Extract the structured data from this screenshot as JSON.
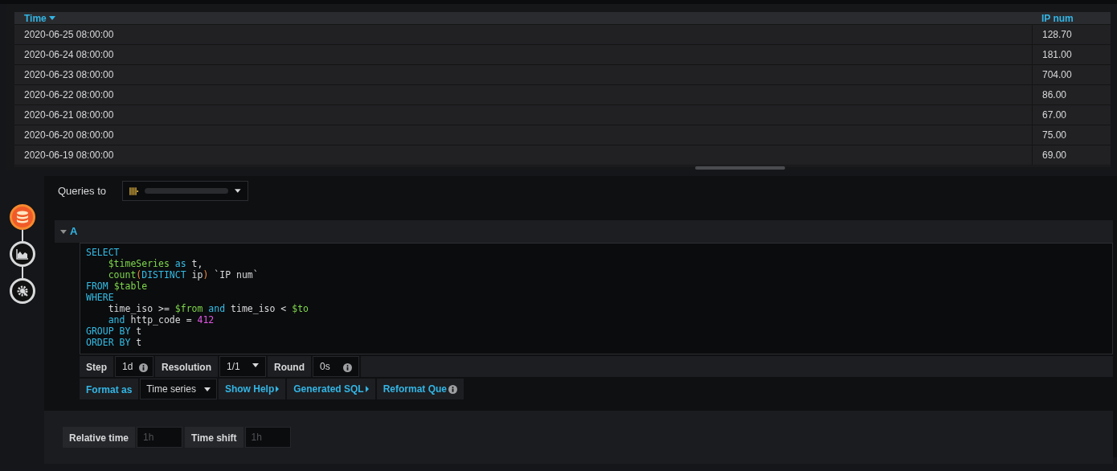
{
  "table": {
    "columns": [
      {
        "label": "Time",
        "sorted": true
      },
      {
        "label": "IP num",
        "sorted": false
      }
    ],
    "rows": [
      [
        "2020-06-25 08:00:00",
        "128.70"
      ],
      [
        "2020-06-24 08:00:00",
        "181.00"
      ],
      [
        "2020-06-23 08:00:00",
        "704.00"
      ],
      [
        "2020-06-22 08:00:00",
        "86.00"
      ],
      [
        "2020-06-21 08:00:00",
        "67.00"
      ],
      [
        "2020-06-20 08:00:00",
        "75.00"
      ],
      [
        "2020-06-19 08:00:00",
        "69.00"
      ]
    ]
  },
  "steps": [
    {
      "kind": "database",
      "selected": true
    },
    {
      "kind": "chart",
      "selected": false
    },
    {
      "kind": "settings",
      "selected": false
    }
  ],
  "queries_to": {
    "label": "Queries to"
  },
  "query": {
    "ref": "A",
    "expanded": true,
    "code": [
      {
        "indent": false,
        "tokens": [
          {
            "kind": "keyword",
            "text": "SELECT"
          }
        ]
      },
      {
        "indent": true,
        "tokens": [
          {
            "kind": "variable",
            "text": "$timeSeries"
          },
          {
            "kind": "keyword",
            "text": " as"
          },
          {
            "kind": "plain",
            "text": " t,"
          }
        ]
      },
      {
        "indent": true,
        "tokens": [
          {
            "kind": "variable",
            "text": "count"
          },
          {
            "kind": "paren",
            "text": "("
          },
          {
            "kind": "keyword",
            "text": "DISTINCT"
          },
          {
            "kind": "plain",
            "text": " ip"
          },
          {
            "kind": "paren",
            "text": ")"
          },
          {
            "kind": "plain",
            "text": " `IP num`"
          }
        ]
      },
      {
        "indent": false,
        "tokens": [
          {
            "kind": "keyword",
            "text": "FROM"
          },
          {
            "kind": "variable",
            "text": " $table"
          }
        ]
      },
      {
        "indent": false,
        "tokens": [
          {
            "kind": "keyword",
            "text": "WHERE"
          }
        ]
      },
      {
        "indent": true,
        "tokens": [
          {
            "kind": "plain",
            "text": "time_iso >= "
          },
          {
            "kind": "variable",
            "text": "$from"
          },
          {
            "kind": "keyword",
            "text": " and"
          },
          {
            "kind": "plain",
            "text": " time_iso < "
          },
          {
            "kind": "variable",
            "text": "$to"
          }
        ]
      },
      {
        "indent": true,
        "tokens": [
          {
            "kind": "keyword",
            "text": "and"
          },
          {
            "kind": "plain",
            "text": " http_code = "
          },
          {
            "kind": "number",
            "text": "412"
          }
        ]
      },
      {
        "indent": false,
        "tokens": [
          {
            "kind": "keyword",
            "text": "GROUP BY"
          },
          {
            "kind": "plain",
            "text": " t"
          }
        ]
      },
      {
        "indent": false,
        "tokens": [
          {
            "kind": "keyword",
            "text": "ORDER BY"
          },
          {
            "kind": "plain",
            "text": " t"
          }
        ]
      }
    ],
    "options": [
      {
        "label": "Step",
        "value": "1d",
        "kind": "info"
      },
      {
        "label": "Resolution",
        "value": "1/1",
        "kind": "select"
      },
      {
        "label": "Round",
        "value": "0s",
        "kind": "info"
      }
    ],
    "format_label": "Format as",
    "format_value": "Time series",
    "links": [
      {
        "label": "Show Help",
        "kind": "toggle"
      },
      {
        "label": "Generated SQL",
        "kind": "toggle"
      },
      {
        "label": "Reformat Que",
        "kind": "info"
      }
    ]
  },
  "time_options": [
    {
      "label": "Relative time",
      "placeholder": "1h"
    },
    {
      "label": "Time shift",
      "placeholder": "1h"
    }
  ]
}
